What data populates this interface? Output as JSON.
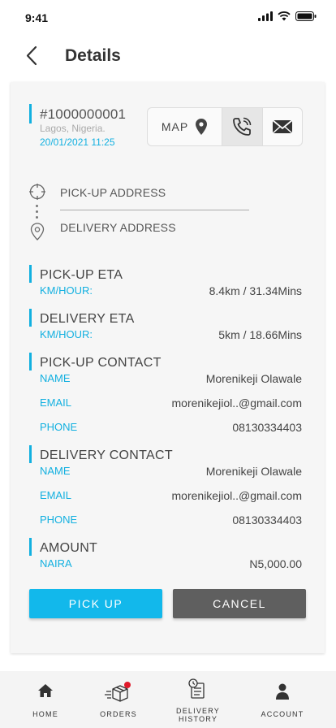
{
  "status": {
    "time": "9:41"
  },
  "header": {
    "title": "Details"
  },
  "order": {
    "id": "#1000000001",
    "location": "Lagos, Nigeria.",
    "datetime": "20/01/2021  11:25"
  },
  "actions": {
    "map_label": "MAP"
  },
  "route": {
    "pickup_label": "PICK-UP ADDRESS",
    "delivery_label": "DELIVERY ADDRESS"
  },
  "pickup_eta": {
    "title": "PICK-UP ETA",
    "label": "KM/HOUR:",
    "value": "8.4km / 31.34Mins"
  },
  "delivery_eta": {
    "title": "DELIVERY ETA",
    "label": "KM/HOUR:",
    "value": "5km / 18.66Mins"
  },
  "pickup_contact": {
    "title": "PICK-UP CONTACT",
    "name_label": "NAME",
    "name": "Morenikeji Olawale",
    "email_label": "EMAIL",
    "email": "morenikejiol..@gmail.com",
    "phone_label": "PHONE",
    "phone": "08130334403"
  },
  "delivery_contact": {
    "title": "DELIVERY CONTACT",
    "name_label": "NAME",
    "name": "Morenikeji Olawale",
    "email_label": "EMAIL",
    "email": "morenikejiol..@gmail.com",
    "phone_label": "PHONE",
    "phone": "08130334403"
  },
  "amount": {
    "title": "AMOUNT",
    "label": "NAIRA",
    "value": "N5,000.00"
  },
  "buttons": {
    "pickup": "PICK UP",
    "cancel": "CANCEL"
  },
  "tabs": {
    "home": "HOME",
    "orders": "ORDERS",
    "history_line1": "DELIVERY",
    "history_line2": "HISTORY",
    "account": "ACCOUNT"
  },
  "colors": {
    "accent": "#12b8eb",
    "cancel": "#5f5f5f",
    "badge": "#e0192a"
  }
}
